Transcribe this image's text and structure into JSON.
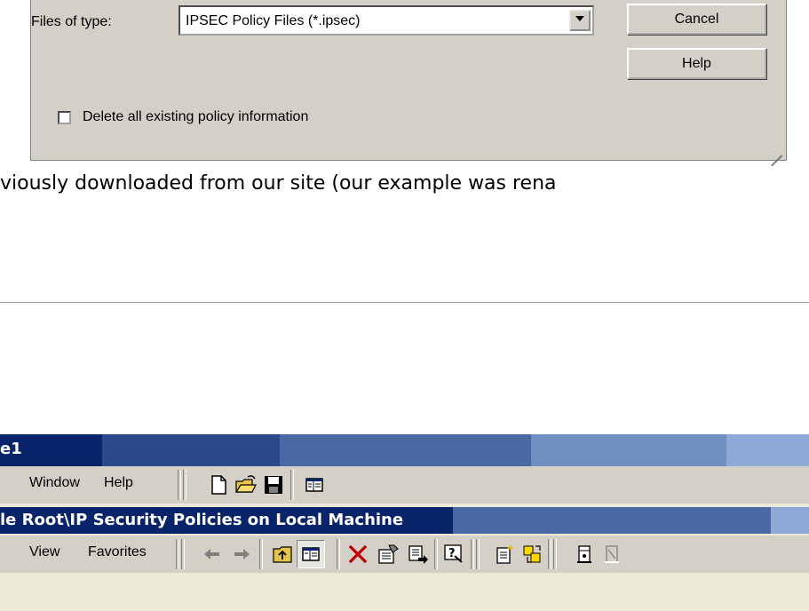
{
  "dialog": {
    "files_of_type_label": "Files of type:",
    "file_type_value": "IPSEC Policy Files (*.ipsec)",
    "cancel_label": "Cancel",
    "help_label": "Help",
    "checkbox_label": "Delete all existing policy information"
  },
  "article": {
    "text": "viously downloaded from our site (our example was rena"
  },
  "mmc": {
    "window_title": "e1",
    "menu": {
      "window": "Window",
      "help": "Help"
    },
    "console_title": "le Root\\IP Security Policies on Local Machine",
    "menu2": {
      "view": "View",
      "favorites": "Favorites"
    }
  },
  "icons": [
    "new-icon",
    "open-icon",
    "save-icon",
    "console-tree-icon",
    "back-icon",
    "forward-icon",
    "up-one-level-icon",
    "show-hide-tree-icon",
    "delete-icon",
    "properties-icon",
    "export-list-icon",
    "help-icon",
    "create-policy-icon",
    "manage-filters-icon",
    "assign-icon",
    "unassign-icon"
  ],
  "colors": {
    "dialog_bg": "#d4d0c8",
    "title_dark": "#0a246a",
    "delete_red": "#c00000"
  }
}
